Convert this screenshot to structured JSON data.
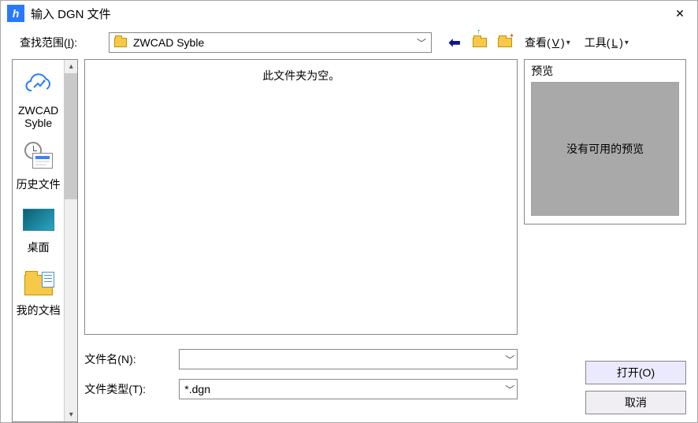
{
  "title": "输入 DGN 文件",
  "lookin": {
    "label_pre": "查找范围(",
    "label_key": "I",
    "label_post": "):",
    "value": "ZWCAD Syble"
  },
  "toolbar": {
    "view_pre": "查看(",
    "view_key": "V",
    "view_post": ")",
    "tools_pre": "工具(",
    "tools_key": "L",
    "tools_post": ")"
  },
  "places": {
    "items": [
      {
        "label": "ZWCAD Syble"
      },
      {
        "label": "历史文件"
      },
      {
        "label": "桌面"
      },
      {
        "label": "我的文档"
      }
    ]
  },
  "filelist": {
    "empty_text": "此文件夹为空。"
  },
  "fields": {
    "filename_pre": "文件名(",
    "filename_key": "N",
    "filename_post": "):",
    "filename_value": "",
    "filetype_pre": "文件类型(",
    "filetype_key": "T",
    "filetype_post": "):",
    "filetype_value": "*.dgn"
  },
  "preview": {
    "title": "预览",
    "no_preview": "没有可用的预览"
  },
  "buttons": {
    "open_pre": "打开(",
    "open_key": "O",
    "open_post": ")",
    "cancel": "取消"
  }
}
